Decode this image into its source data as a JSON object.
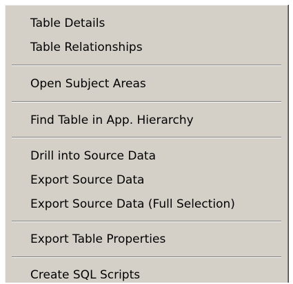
{
  "menu": {
    "items": [
      {
        "label": "Table Details"
      },
      {
        "label": "Table Relationships"
      },
      {
        "label": "Open Subject Areas"
      },
      {
        "label": "Find Table in App. Hierarchy"
      },
      {
        "label": "Drill into Source Data"
      },
      {
        "label": "Export Source Data"
      },
      {
        "label": "Export Source Data (Full Selection)"
      },
      {
        "label": "Export Table Properties"
      },
      {
        "label": "Create SQL Scripts"
      }
    ]
  }
}
